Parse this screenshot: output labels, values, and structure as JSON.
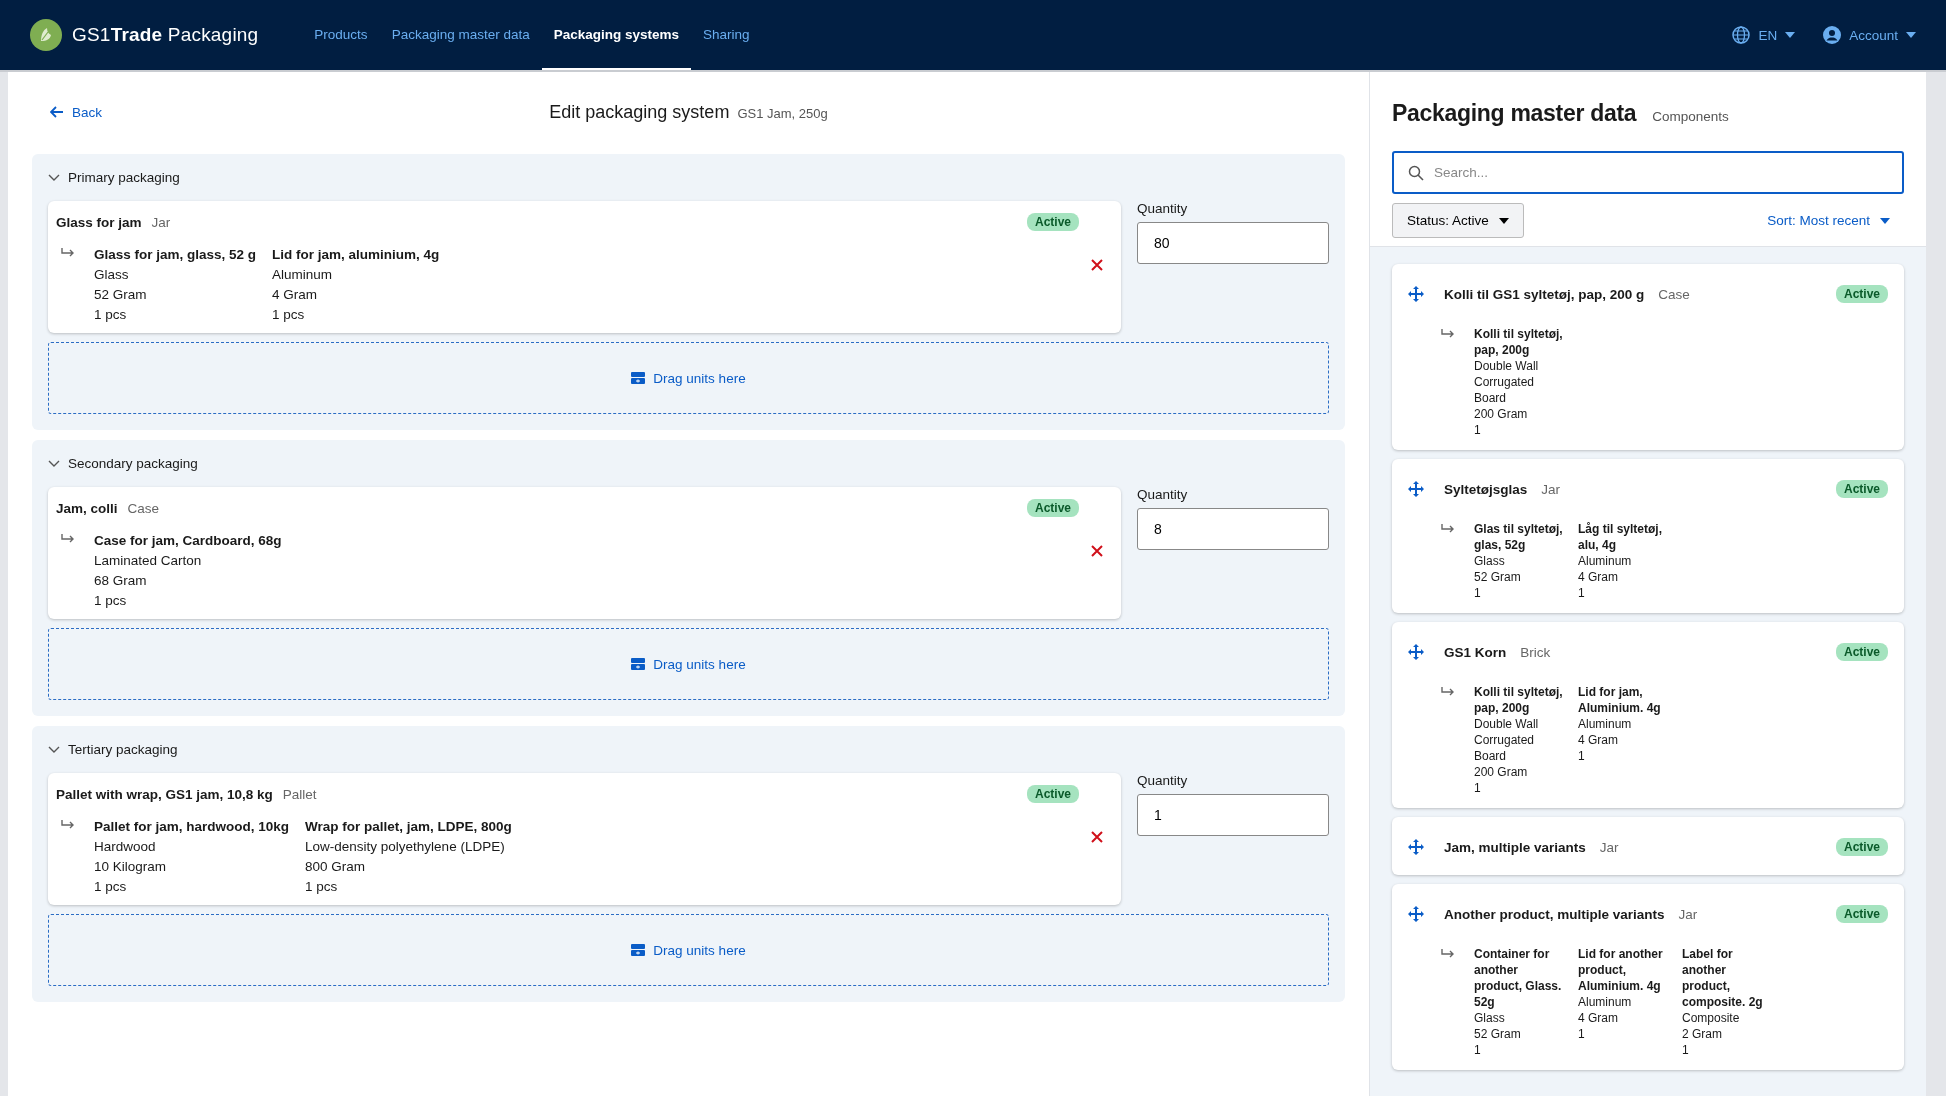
{
  "nav": {
    "brand": "GS1**Trade** Packaging",
    "links": [
      {
        "label": "Products",
        "selected": false
      },
      {
        "label": "Packaging master data",
        "selected": false
      },
      {
        "label": "Packaging systems",
        "selected": true
      },
      {
        "label": "Sharing",
        "selected": false
      }
    ],
    "language": "EN",
    "account": "Account"
  },
  "editor": {
    "back": "Back",
    "title": "Edit packaging system",
    "subtitle": "GS1 Jam, 250g",
    "sections": [
      {
        "title": "Primary packaging",
        "expanded": true,
        "item": {
          "name": "Glass for jam",
          "type": "Jar",
          "status": "Active",
          "components": [
            {
              "name": "Glass for jam, glass, 52 g",
              "material": "Glass",
              "weight": "52 Gram",
              "count": "1 pcs"
            },
            {
              "name": "Lid for jam, aluminium, 4g",
              "material": "Aluminum",
              "weight": "4 Gram",
              "count": "1 pcs"
            }
          ]
        },
        "quantity_label": "Quantity",
        "quantity": "80",
        "drop_zone": "Drag units here"
      },
      {
        "title": "Secondary packaging",
        "expanded": true,
        "item": {
          "name": "Jam, colli",
          "type": "Case",
          "status": "Active",
          "components": [
            {
              "name": "Case for jam, Cardboard, 68g",
              "material": "Laminated Carton",
              "weight": "68 Gram",
              "count": "1 pcs"
            }
          ]
        },
        "quantity_label": "Quantity",
        "quantity": "8",
        "drop_zone": "Drag units here"
      },
      {
        "title": "Tertiary packaging",
        "expanded": true,
        "item": {
          "name": "Pallet with wrap, GS1 jam, 10,8 kg",
          "type": "Pallet",
          "status": "Active",
          "components": [
            {
              "name": "Pallet for jam, hardwood, 10kg",
              "material": "Hardwood",
              "weight": "10 Kilogram",
              "count": "1 pcs"
            },
            {
              "name": "Wrap for pallet, jam, LDPE, 800g",
              "material": "Low-density polyethylene (LDPE)",
              "weight": "800 Gram",
              "count": "1 pcs"
            }
          ]
        },
        "quantity_label": "Quantity",
        "quantity": "1",
        "drop_zone": "Drag units here"
      }
    ]
  },
  "master_data": {
    "title": "Packaging master data",
    "subtitle": "Components",
    "search": {
      "placeholder": "Search..."
    },
    "status_filter": "Status: Active",
    "sort": "Sort: Most recent",
    "cards": [
      {
        "name": "Kolli til GS1 syltetøj, pap, 200 g",
        "type": "Case",
        "status": "Active",
        "components": [
          {
            "name": "Kolli til syltetøj, pap, 200g",
            "material": "Double Wall Corrugated Board",
            "weight": "200 Gram",
            "count": "1"
          }
        ]
      },
      {
        "name": "Syltetøjsglas",
        "type": "Jar",
        "status": "Active",
        "components": [
          {
            "name": "Glas til syltetøj, glas, 52g",
            "material": "Glass",
            "weight": "52 Gram",
            "count": "1"
          },
          {
            "name": "Låg til syltetøj, alu, 4g",
            "material": "Aluminum",
            "weight": "4 Gram",
            "count": "1"
          }
        ]
      },
      {
        "name": "GS1 Korn",
        "type": "Brick",
        "status": "Active",
        "components": [
          {
            "name": "Kolli til syltetøj, pap, 200g",
            "material": "Double Wall Corrugated Board",
            "weight": "200 Gram",
            "count": "1"
          },
          {
            "name": "Lid for jam, Aluminium. 4g",
            "material": "Aluminum",
            "weight": "4 Gram",
            "count": "1"
          }
        ]
      },
      {
        "name": "Jam, multiple variants",
        "type": "Jar",
        "status": "Active"
      },
      {
        "name": "Another product, multiple variants",
        "type": "Jar",
        "status": "Active",
        "components": [
          {
            "name": "Container for another product, Glass. 52g",
            "material": "Glass",
            "weight": "52 Gram",
            "count": "1"
          },
          {
            "name": "Lid for another product, Aluminium. 4g",
            "material": "Aluminum",
            "weight": "4 Gram",
            "count": "1"
          },
          {
            "name": "Label for another product, composite. 2g",
            "material": "Composite",
            "weight": "2 Gram",
            "count": "1"
          }
        ]
      }
    ]
  }
}
